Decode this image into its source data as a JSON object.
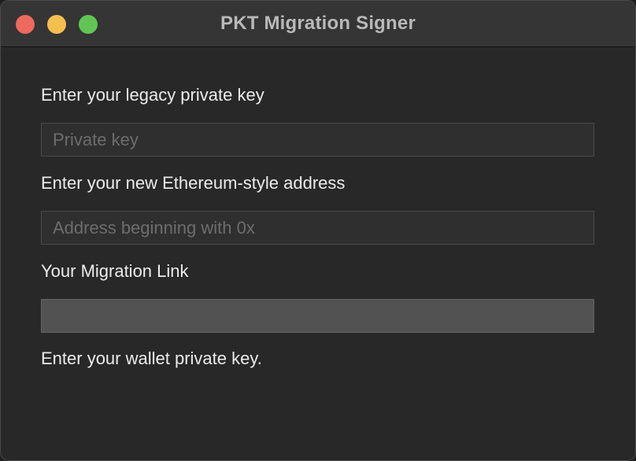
{
  "window": {
    "title": "PKT Migration Signer",
    "controls": [
      "close",
      "minimize",
      "zoom"
    ],
    "colors": {
      "close": "#ed6a5e",
      "minimize": "#f4bf4f",
      "zoom": "#61c554"
    }
  },
  "form": {
    "private_key": {
      "label": "Enter your legacy private key",
      "placeholder": "Private key",
      "value": ""
    },
    "address": {
      "label": "Enter your new Ethereum-style address",
      "placeholder": "Address beginning with 0x",
      "value": ""
    },
    "migration_link": {
      "label": "Your Migration Link",
      "value": ""
    }
  },
  "status": {
    "message": "Enter your wallet private key."
  }
}
